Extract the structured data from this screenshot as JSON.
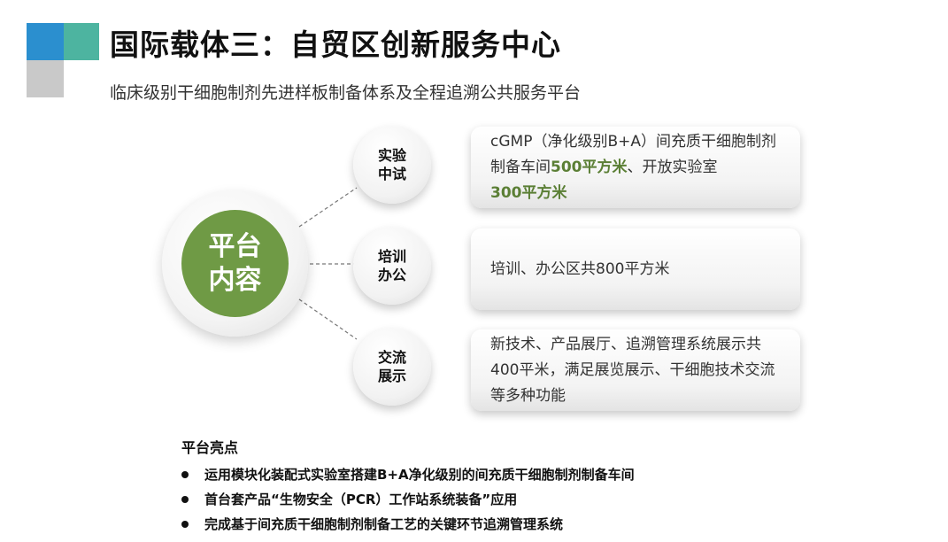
{
  "header": {
    "title": "国际载体三：自贸区创新服务中心",
    "subtitle": "临床级别干细胞制剂先进样板制备体系及全程追溯公共服务平台"
  },
  "center": {
    "line1": "平台",
    "line2": "内容"
  },
  "nodes": [
    {
      "line1": "实验",
      "line2": "中试",
      "box_parts": {
        "a": "cGMP（净化级别B+A）间充质干细胞制剂制备车间",
        "b": "500平方米",
        "c": "、开放实验室",
        "d": "300平方米"
      }
    },
    {
      "line1": "培训",
      "line2": "办公",
      "box_text": "培训、办公区共800平方米"
    },
    {
      "line1": "交流",
      "line2": "展示",
      "box_text": "新技术、产品展厅、追溯管理系统展示共400平米，满足展览展示、干细胞技术交流等多种功能"
    }
  ],
  "highlights": {
    "title": "平台亮点",
    "items": [
      "运用模块化装配式实验室搭建B+A净化级别的间充质干细胞制剂制备车间",
      "首台套产品“生物安全（PCR）工作站系统装备”应用",
      "完成基于间充质干细胞制剂制备工艺的关键环节追溯管理系统"
    ]
  },
  "colors": {
    "accent_green": "#6f9a45",
    "highlight_green": "#5b7f35",
    "square_blue": "#2b8fcf",
    "square_teal": "#4db4a0",
    "square_gray": "#c9c9c9"
  }
}
